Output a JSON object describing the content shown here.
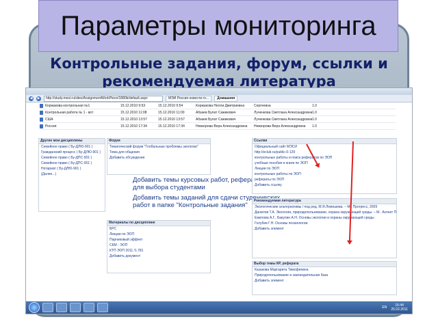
{
  "slide": {
    "title": "Параметры  мониторинга",
    "subtitle_line1": "Контрольные задания, форум, ссылки и",
    "subtitle_line2": "рекомендуемая литература"
  },
  "browser": {
    "url": "http://study.mesi.ru/sites/AssignmentWorkPiece/1880b/default.aspx",
    "tabs": [
      "МЭИ Россия новости го...",
      "Домашняя"
    ]
  },
  "top_rows": [
    {
      "name": "Коржакова контрольная №1",
      "date1": "15.12.2010 9:53",
      "date2": "15.12.2010 9:54",
      "author": "Коржакова Нелли Дмитриевна",
      "reviewer": "Сергеевна",
      "score": "1.0"
    },
    {
      "name": "Контрольная работа № 1 - вот",
      "date1": "15.12.2010 11:08",
      "date2": "15.12.2010 11:00",
      "author": "Абзаев Булат Сажикович",
      "reviewer": "Лученкова Светлана Александровна",
      "score": "1.0"
    },
    {
      "name": "США",
      "date1": "15.12.2010 13:57",
      "date2": "15.12.2010 13:57",
      "author": "Абзаев Булат Сажикович",
      "reviewer": "Лученкова Светлана Александровна",
      "score": "1.0"
    },
    {
      "name": "Россия",
      "date1": "15.12.2010 17:34",
      "date2": "15.12.2010 17:34",
      "author": "Невзорова Вера Александровна",
      "reviewer": "Невзорова Вера Александровна",
      "score": "1.0"
    }
  ],
  "other_disciplines": {
    "title": "Другие мои дисциплины",
    "rows": [
      "Семейное право ( Бу-ДЛЮ-901 )",
      "Гражданский процесс ( Бу-ДЛЮ-901 )",
      "Семейное право ( Бу-ДПС-901 )",
      "Семейное право ( Бу-ДПС-901 )",
      "Нотариат ( Бу-ДЛЮ-901 )",
      "(Далее...)"
    ]
  },
  "forum": {
    "title": "Форум",
    "rows": [
      "Тематический форум \"Глобальные проблемы экологии\"",
      "Тема для общения"
    ],
    "add": "Добавить обсуждение"
  },
  "big_links": [
    "Добавить темы курсовых работ, рефератов, эссе для выбора студентами",
    "Добавить темы заданий для сдачи студенческих работ в папке \"Контрольные задания\""
  ],
  "materials": {
    "title": "Материалы по дисциплине",
    "rows": [
      "БРС",
      "Лекции по ЭОП",
      "Парниковый эффект",
      "СКМ - ЭОП",
      "КТП ЭОП 2011 /1.781"
    ],
    "add": "Добавить документ"
  },
  "links": {
    "title": "Ссылки",
    "rows": [
      "Официальный сайт МЭСИ",
      "http://eclub.ru/public-0-129",
      "контрольные работы и поиск рефератов по ЭОП",
      "учебные пособия и книги по ЭОП",
      "Лекции по ЭОП",
      "контрольные работы по ЭОП",
      "рефераты по ЭОП"
    ],
    "add": "Добавить ссылку"
  },
  "literature": {
    "title": "Рекомендуемая литература",
    "rows": [
      "Экологические альтернативы / под ред. М.Я.Лемешева. – М.: Прогресс, 2009",
      "Данилов Т.А. Экология, природопользование, охрана окружающей среды. – М.: Аспект Пресс, 2007",
      "Ежилова А.Г., Бакулин А.Н. Основы экологии и охраны окружающей среды",
      "Голубев Г.Н. Основы геоэкологии"
    ],
    "add": "Добавить элемент"
  },
  "essay_choice": {
    "title": "Выбор темы КР, реферата",
    "rows": [
      "Казакова Маргарита Тимофеевна",
      "Природопользование и законодательная база"
    ],
    "add": "Добавить элемент"
  },
  "taskbar": {
    "lang": "EN",
    "time": "16:44",
    "date": "25.02.2011"
  }
}
